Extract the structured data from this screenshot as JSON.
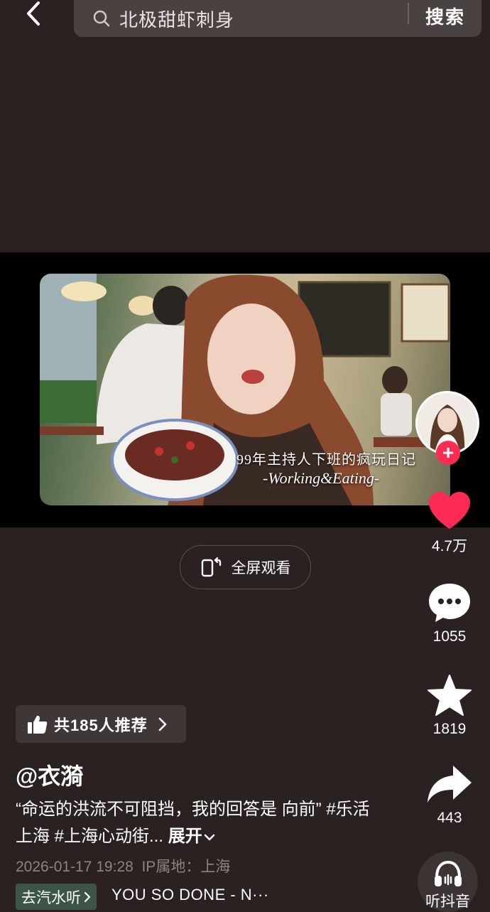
{
  "search": {
    "query": "北极甜虾刺身",
    "button_label": "搜索"
  },
  "video": {
    "caption_line1": "99年主持人下班的疯玩日记",
    "caption_line2": "-Working&Eating-"
  },
  "fullscreen": {
    "label": "全屏观看"
  },
  "rail": {
    "like_count": "4.7万",
    "comment_count": "1055",
    "favorite_count": "1819",
    "share_count": "443",
    "listen_label": "听抖音",
    "follow_symbol": "+",
    "like_color": "#fe2c55"
  },
  "recommend": {
    "label": "共185人推荐"
  },
  "post": {
    "author": "@衣漪",
    "description": "“命运的洪流不可阻挡，我的回答是 向前” #乐活上海 #上海心动街...",
    "expand_label": "展开",
    "meta": "2026-01-17 19:28  IP属地：上海"
  },
  "music": {
    "chip_label": "去汽水听",
    "title": "YOU SO DONE - N···"
  }
}
